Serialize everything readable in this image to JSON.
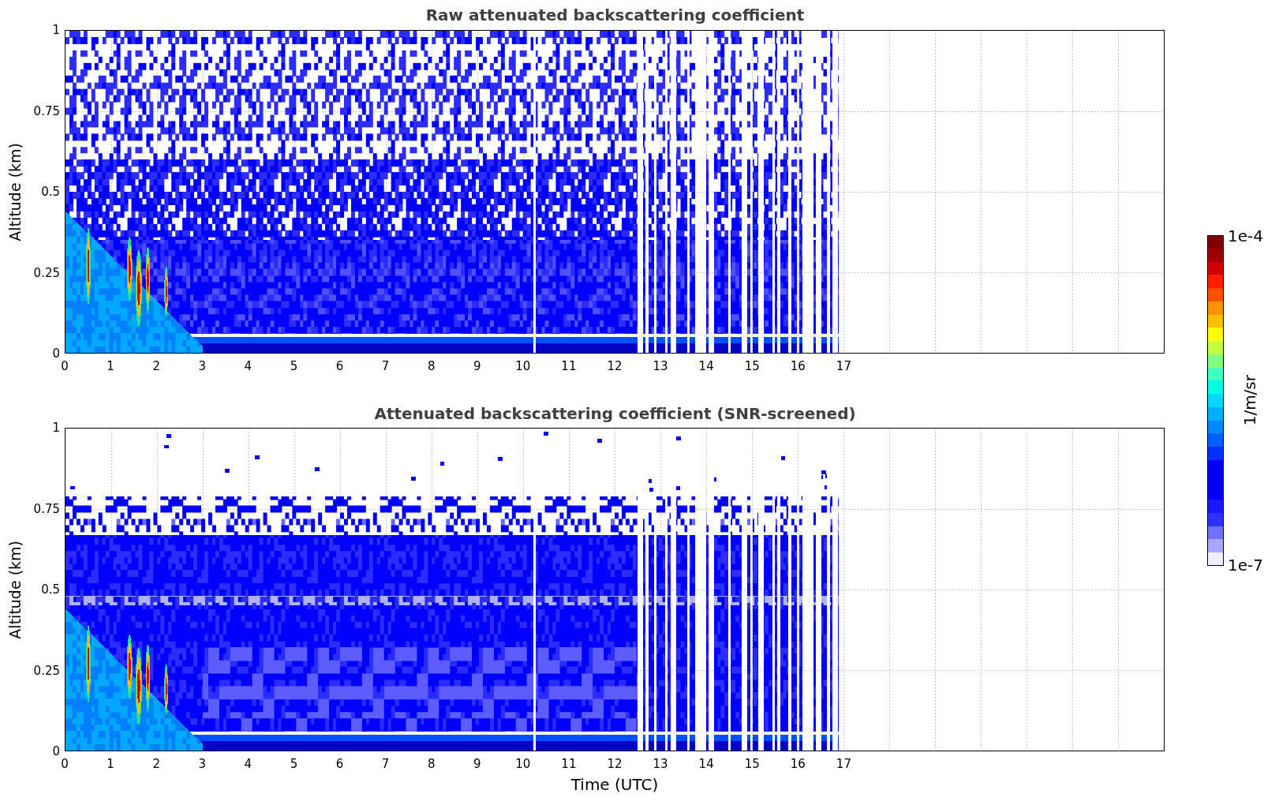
{
  "figure": {
    "panels": [
      {
        "kind": "raw",
        "title": "Raw attenuated backscattering coefficient",
        "ylabel": "Altitude (km)",
        "yticks": [
          "1",
          "0.75",
          "0.5",
          "0.25",
          "0"
        ],
        "xticks": [
          "0",
          "1",
          "2",
          "3",
          "4",
          "5",
          "6",
          "7",
          "8",
          "9",
          "10",
          "11",
          "12",
          "13",
          "14",
          "15",
          "16",
          "17"
        ]
      },
      {
        "kind": "screened",
        "title": "Attenuated backscattering coefficient (SNR-screened)",
        "ylabel": "Altitude (km)",
        "yticks": [
          "1",
          "0.75",
          "0.5",
          "0.25",
          "0"
        ],
        "xticks": [
          "0",
          "1",
          "2",
          "3",
          "4",
          "5",
          "6",
          "7",
          "8",
          "9",
          "10",
          "11",
          "12",
          "13",
          "14",
          "15",
          "16",
          "17"
        ],
        "xlabel": "Time (UTC)"
      }
    ],
    "colorbar": {
      "label": "1/m/sr",
      "max_label": "1e-4",
      "min_label": "1e-7"
    }
  }
}
